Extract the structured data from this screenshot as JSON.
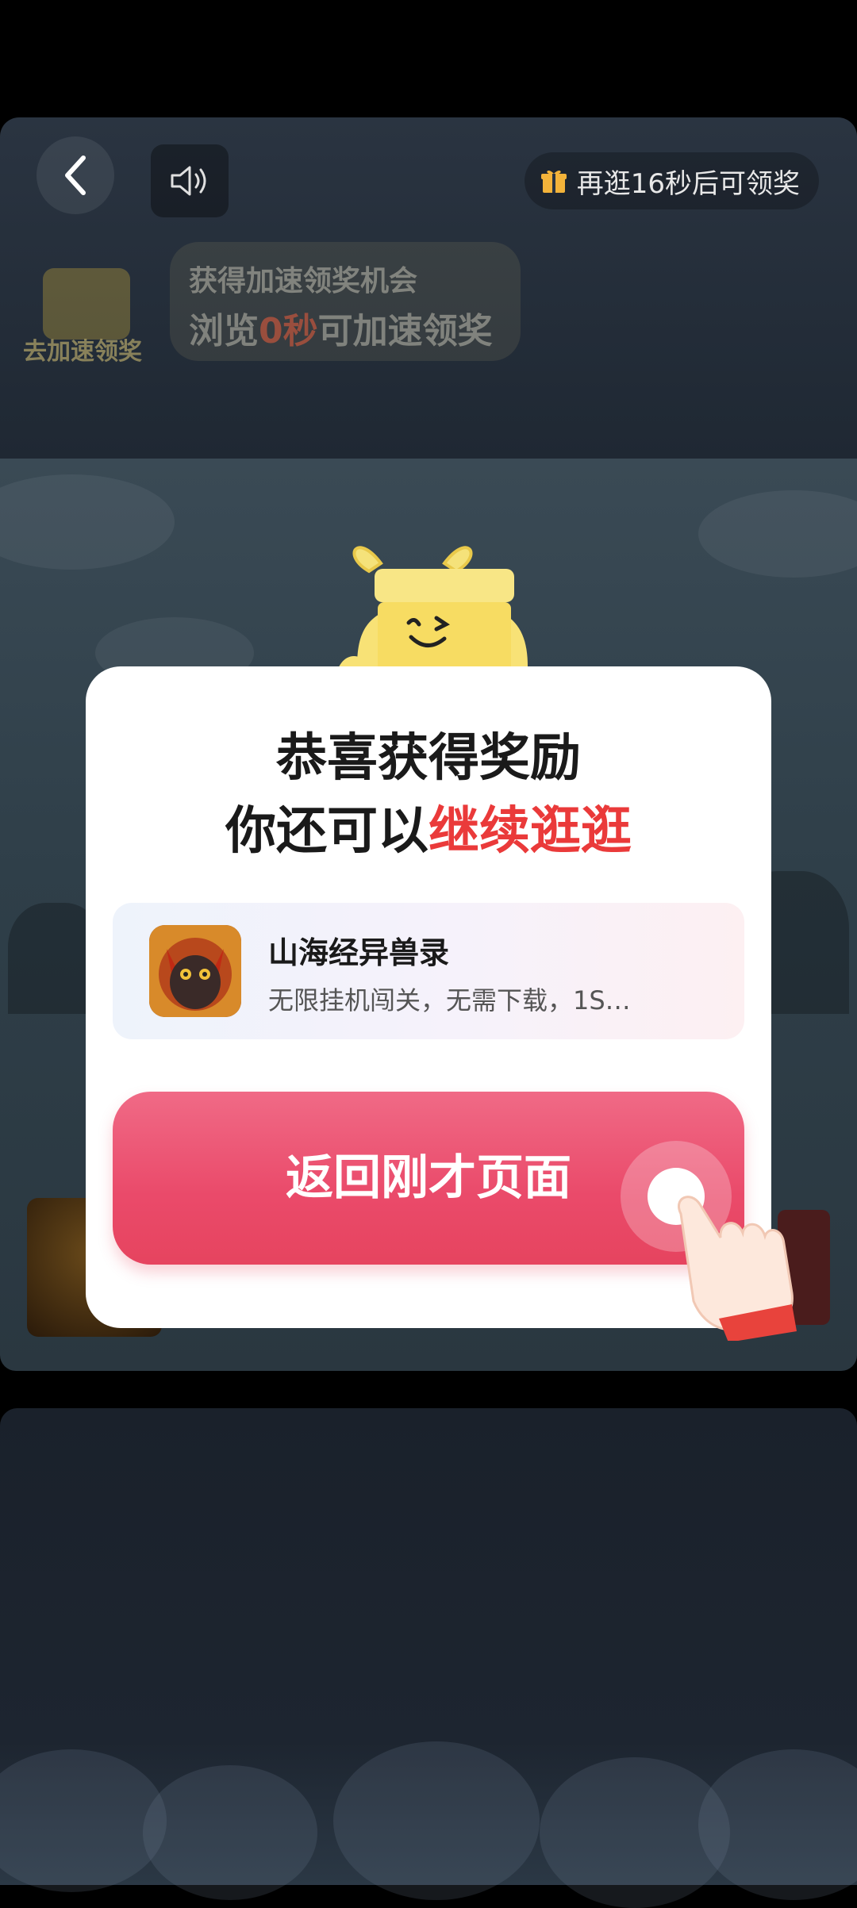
{
  "header": {
    "reward_timer_text": "再逛16秒后可领奖"
  },
  "speed_card": {
    "line1": "获得加速领奖机会",
    "line2_prefix": "浏览",
    "line2_highlight": "0秒",
    "line2_suffix": "可加速领奖",
    "mascot_label": "去加速领奖"
  },
  "dialog": {
    "title_line1": "恭喜获得奖励",
    "title_line2_prefix": "你还可以",
    "title_line2_highlight": "继续逛逛",
    "app": {
      "name": "山海经异兽录",
      "description": "无限挂机闯关，无需下载，1S…"
    },
    "return_button_label": "返回刚才页面"
  },
  "colors": {
    "accent_red": "#ea3a3a",
    "button_pink": "#ea4a6a"
  },
  "icons": [
    "back-arrow-icon",
    "speaker-icon",
    "gift-icon",
    "tap-hand-icon"
  ]
}
